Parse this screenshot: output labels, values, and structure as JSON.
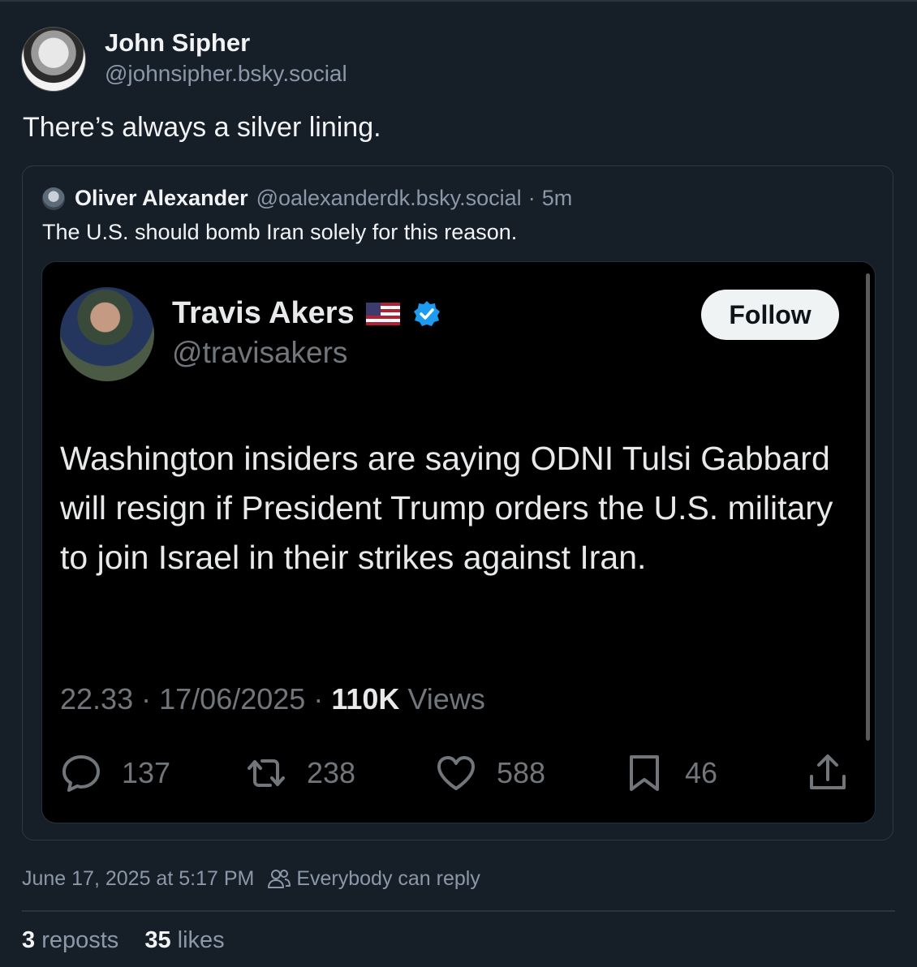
{
  "author": {
    "name": "John Sipher",
    "handle": "@johnsipher.bsky.social"
  },
  "post": {
    "text": "There’s always a silver lining."
  },
  "quote": {
    "name": "Oliver Alexander",
    "handle": "@oalexanderdk.bsky.social",
    "separator": "·",
    "time": "5m",
    "text": "The U.S. should bomb Iran solely for this reason."
  },
  "tweet": {
    "name": "Travis Akers",
    "handle": "@travisakers",
    "follow_label": "Follow",
    "body": "Washington insiders are saying ODNI Tulsi Gabbard will resign if President Trump orders the U.S. military to join Israel in their strikes against Iran.",
    "time": "22.33",
    "date": "17/06/2025",
    "sep": "·",
    "views_count": "110K",
    "views_label": "Views",
    "replies": "137",
    "retweets": "238",
    "likes": "588",
    "bookmarks": "46",
    "icons": [
      "reply-icon",
      "retweet-icon",
      "heart-icon",
      "bookmark-icon",
      "share-icon"
    ],
    "verified_color": "#1d9bf0"
  },
  "footer": {
    "timestamp": "June 17, 2025 at 5:17 PM",
    "reply_setting": "Everybody can reply",
    "reposts_count": "3",
    "reposts_label": "reposts",
    "likes_count": "35",
    "likes_label": "likes"
  },
  "colors": {
    "background": "#161e27",
    "muted": "#8b98a9",
    "text": "#f1f3f5"
  }
}
